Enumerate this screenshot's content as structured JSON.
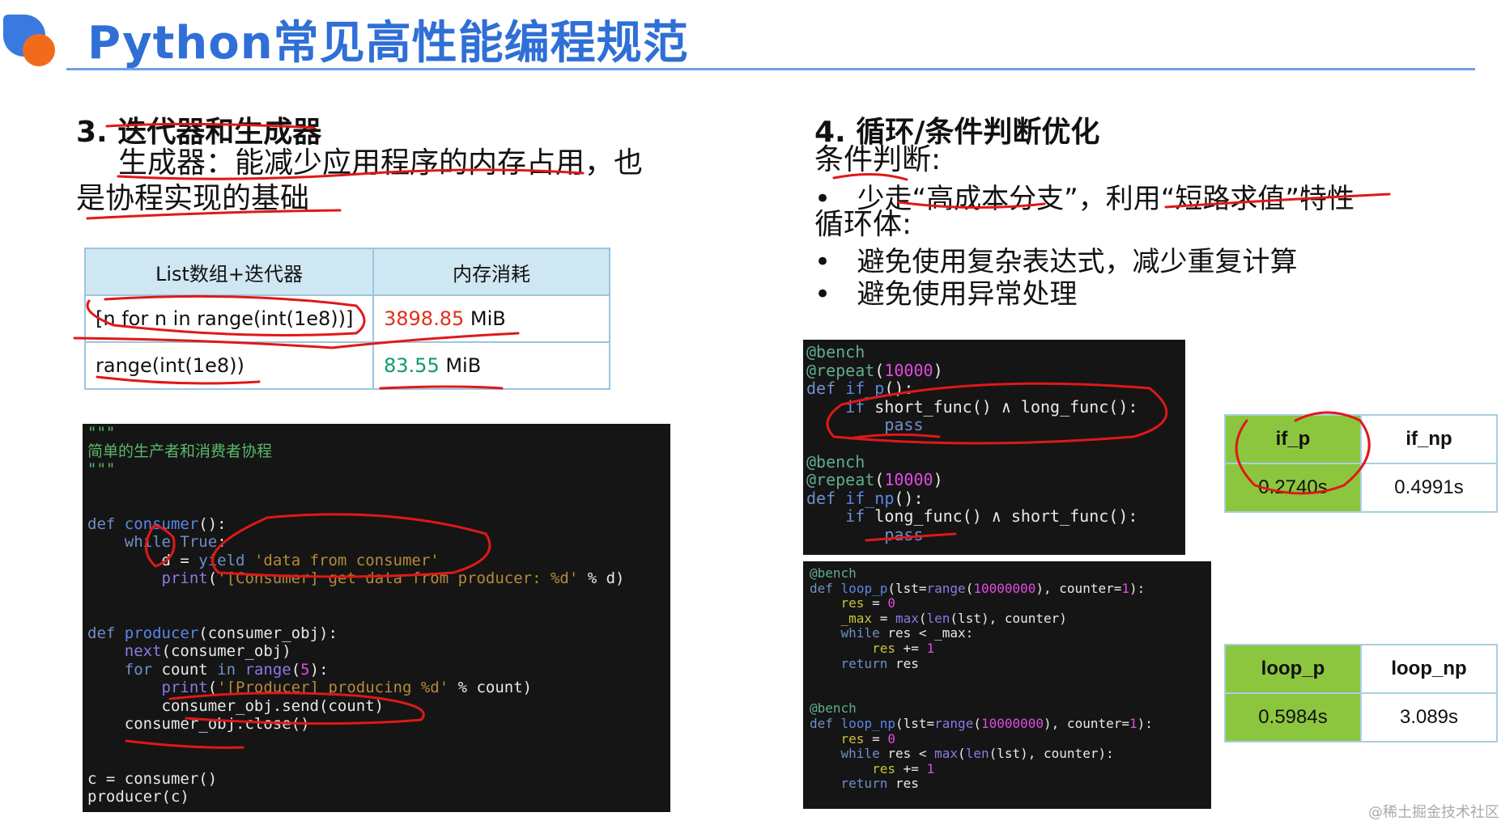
{
  "header": {
    "title": "Python常见高性能编程规范"
  },
  "left": {
    "heading": "3. 迭代器和生成器",
    "desc_line1": "生成器：能减少应用程序的内存占用，也",
    "desc_line2": "是协程实现的基础",
    "table": {
      "headers": [
        "List数组+迭代器",
        "内存消耗"
      ],
      "rows": [
        {
          "expr": "[n for n in range(int(1e8))]",
          "value": "3898.85",
          "unit": " MiB"
        },
        {
          "expr": "range(int(1e8))",
          "value": "83.55",
          "unit": " MiB"
        }
      ]
    }
  },
  "right": {
    "heading": "4. 循环/条件判断优化",
    "cond_label": "条件判断:",
    "bullet1": "少走“高成本分支”，利用“短路求值”特性",
    "loop_label": "循环体:",
    "bullet2": "避免使用复杂表达式，减少重复计算",
    "bullet3": "避免使用异常处理"
  },
  "results": {
    "if": {
      "headers": [
        "if_p",
        "if_np"
      ],
      "values": [
        "0.2740s",
        "0.4991s"
      ]
    },
    "loop": {
      "headers": [
        "loop_p",
        "loop_np"
      ],
      "values": [
        "0.5984s",
        "3.089s"
      ]
    }
  },
  "watermark": "@稀土掘金技术社区",
  "colors": {
    "title": "#2f6fd6",
    "red_value": "#e0301e",
    "green_value": "#12996a",
    "highlight": "#8cc63f"
  }
}
